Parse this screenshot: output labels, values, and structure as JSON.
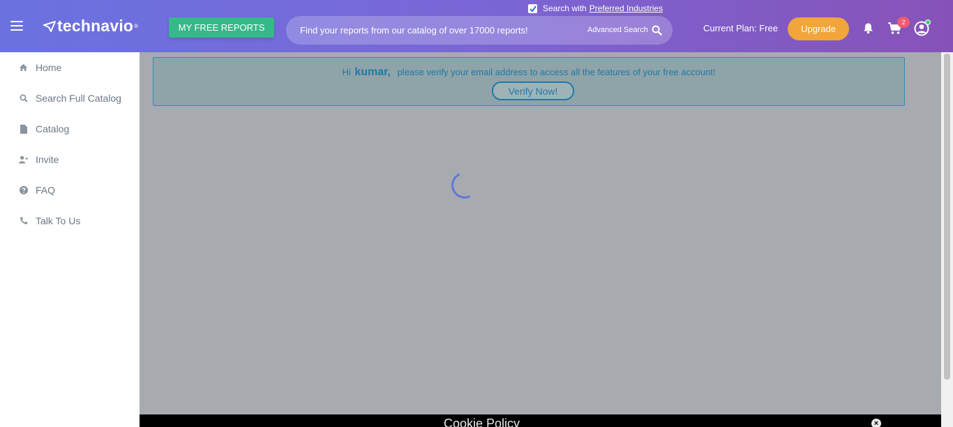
{
  "header": {
    "logo_text": "technavio",
    "logo_mark": "®",
    "free_reports_label": "MY FREE REPORTS",
    "preferred": {
      "label": "Search with",
      "link": "Preferred Industries",
      "checked": true
    },
    "search": {
      "placeholder": "Find your reports from our catalog of over 17000 reports!",
      "advanced_label": "Advanced Search"
    },
    "plan_text": "Current Plan: Free",
    "upgrade_label": "Upgrade",
    "cart_count": "2"
  },
  "sidebar": {
    "items": [
      {
        "label": "Home",
        "icon": "home-icon"
      },
      {
        "label": "Search Full Catalog",
        "icon": "search-icon"
      },
      {
        "label": "Catalog",
        "icon": "file-icon"
      },
      {
        "label": "Invite",
        "icon": "user-plus-icon"
      },
      {
        "label": "FAQ",
        "icon": "question-icon"
      },
      {
        "label": "Talk To Us",
        "icon": "phone-icon"
      }
    ]
  },
  "banner": {
    "hi": "Hi",
    "name": "kumar,",
    "message": "please verify your email address to access all the features of your free account!",
    "verify_label": "Verify Now!"
  },
  "cookie": {
    "title": "Cookie Policy",
    "close": "×"
  },
  "colors": {
    "header_start": "#6a72e0",
    "header_end": "#8752b8",
    "free_reports_bg": "#35b88a",
    "upgrade_bg": "#f2a53a",
    "badge_bg": "#f05a6e",
    "banner_text": "#1f79a8"
  }
}
